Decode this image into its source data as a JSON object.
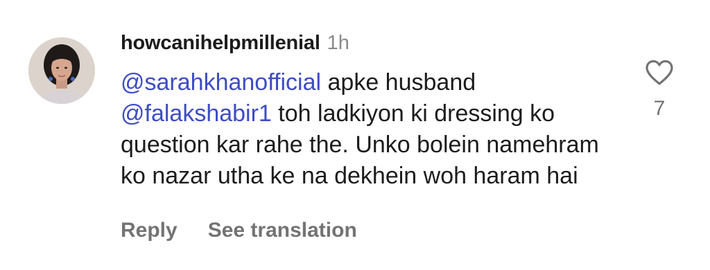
{
  "comment": {
    "avatar_icon": "profile-photo",
    "username": "howcanihelpmillenial",
    "time": "1h",
    "mention_1": "@sarahkhanofficial",
    "text_1": " apke husband ",
    "mention_2": "@falakshabir1",
    "text_2": " toh ladkiyon ki dressing ko question kar rahe the. Unko bolein namehram ko nazar utha ke na dekhein woh haram hai",
    "like_icon": "heart-outline-icon",
    "like_count": "7",
    "reply_label": "Reply",
    "translation_label": "See translation"
  },
  "colors": {
    "mention": "#3d4cc4",
    "secondary_text": "#737373",
    "username": "#1c1c1c"
  }
}
